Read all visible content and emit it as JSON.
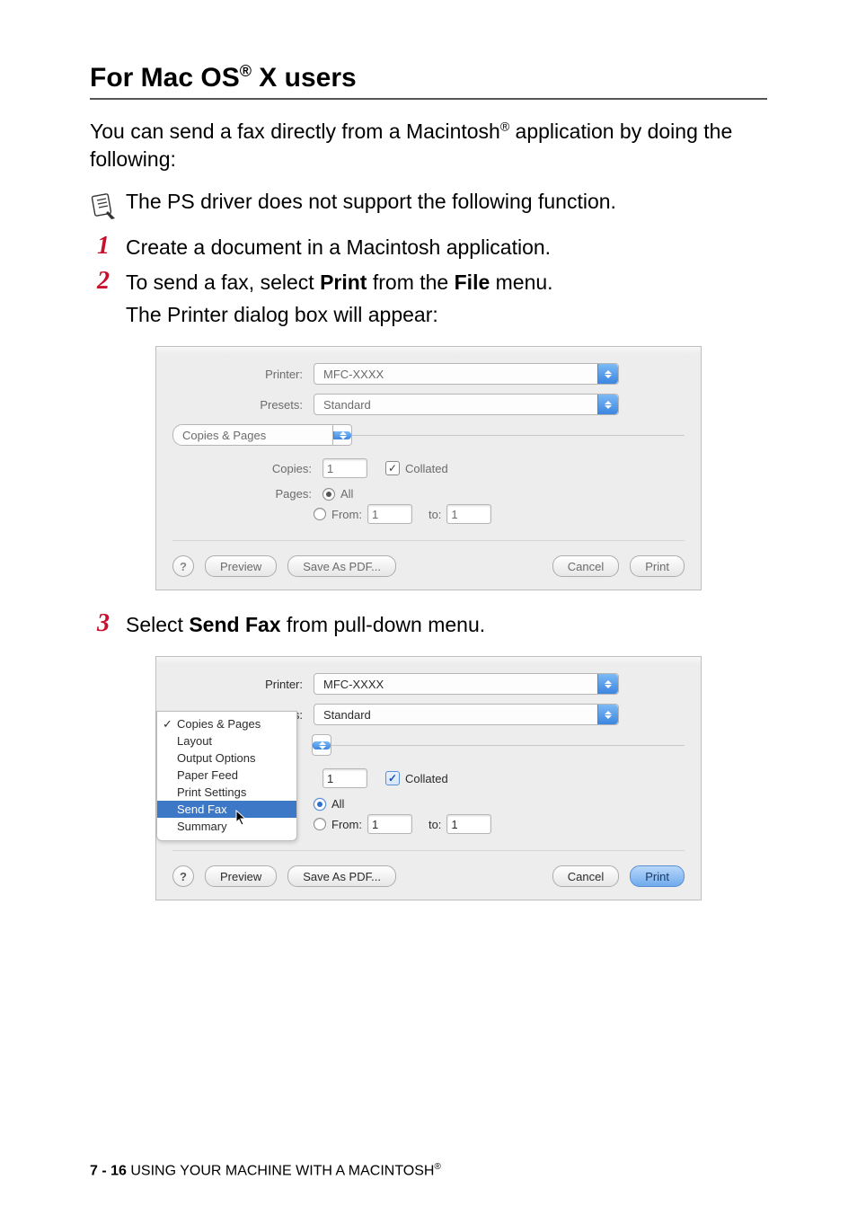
{
  "heading": {
    "prefix": "For Mac OS",
    "reg": "®",
    "suffix": " X users"
  },
  "intro": {
    "p1a": "You can send a fax directly from a Macintosh",
    "p1reg": "®",
    "p1b": " application by doing the following:"
  },
  "note": "The PS driver does not support the following function.",
  "steps": {
    "s1": {
      "num": "1",
      "text": "Create a document in a Macintosh application."
    },
    "s2": {
      "num": "2",
      "line1a": "To send a fax, select ",
      "line1b": "Print",
      "line1c": " from the ",
      "line1d": "File",
      "line1e": " menu.",
      "line2": "The Printer dialog box will appear:"
    },
    "s3": {
      "num": "3",
      "a": "Select ",
      "b": "Send Fax",
      "c": " from pull-down menu."
    }
  },
  "dialog": {
    "printer_label": "Printer:",
    "printer_value": "MFC-XXXX",
    "presets_label": "Presets:",
    "presets_value": "Standard",
    "section": "Copies & Pages",
    "copies_label": "Copies:",
    "copies_value": "1",
    "collated": "Collated",
    "pages_label": "Pages:",
    "all": "All",
    "from": "From:",
    "from_value": "1",
    "to": "to:",
    "to_value": "1",
    "help": "?",
    "preview_btn": "Preview",
    "save_pdf_btn": "Save As PDF...",
    "cancel_btn": "Cancel",
    "print_btn": "Print"
  },
  "menu": {
    "items": [
      "Copies & Pages",
      "Layout",
      "Output Options",
      "Paper Feed",
      "Print Settings",
      "Send Fax",
      "Summary"
    ]
  },
  "footer": {
    "page": "7 - 16",
    "text": "   USING YOUR MACHINE WITH A MACINTOSH",
    "reg": "®"
  }
}
